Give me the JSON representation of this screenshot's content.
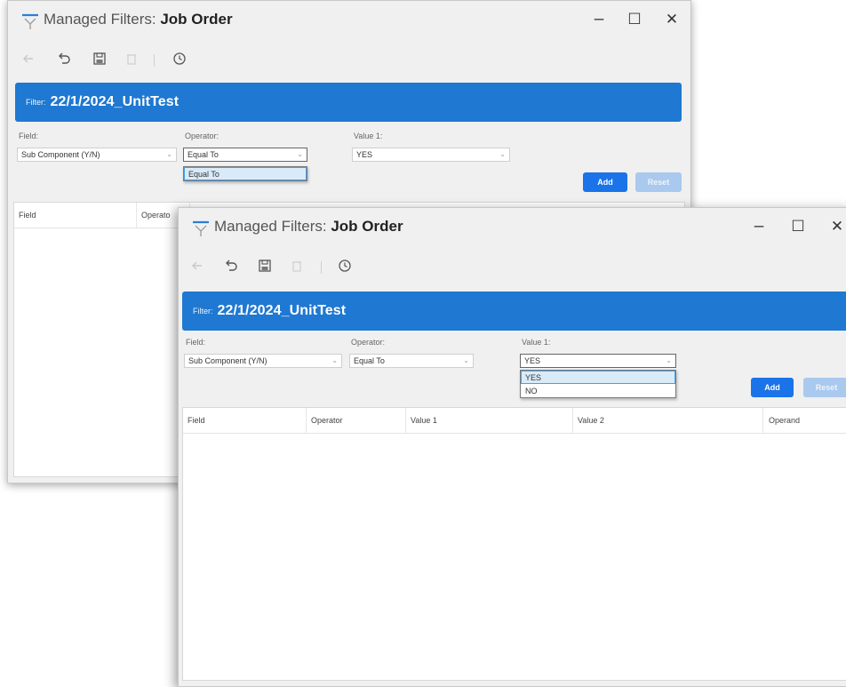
{
  "colors": {
    "accent": "#1f78d1",
    "add_button": "#1a73e8",
    "reset_button": "#a9c9ee"
  },
  "windows": [
    {
      "title_prefix": "Managed Filters: ",
      "title_entity": "Job Order",
      "window_controls": {
        "minimize": "–",
        "maximize": "☐",
        "close": "✕"
      },
      "toolbar_icons": [
        "back-arrow-icon",
        "undo-icon",
        "save-icon",
        "delete-icon",
        "history-icon"
      ],
      "filter_label": "Filter:",
      "filter_name": "22/1/2024_UnitTest",
      "field_label": "Field:",
      "field_value": "Sub Component (Y/N)",
      "operator_label": "Operator:",
      "operator_value": "Equal To",
      "value1_label": "Value 1:",
      "value1_value": "YES",
      "operator_dropdown": {
        "open": true,
        "options": [
          "Equal To"
        ],
        "selected": "Equal To"
      },
      "add_label": "Add",
      "reset_label": "Reset",
      "columns": [
        "Field",
        "Operato"
      ]
    },
    {
      "title_prefix": "Managed Filters: ",
      "title_entity": "Job Order",
      "window_controls": {
        "minimize": "–",
        "maximize": "☐",
        "close": "✕"
      },
      "toolbar_icons": [
        "back-arrow-icon",
        "undo-icon",
        "save-icon",
        "delete-icon",
        "history-icon"
      ],
      "filter_label": "Filter:",
      "filter_name": "22/1/2024_UnitTest",
      "field_label": "Field:",
      "field_value": "Sub Component (Y/N)",
      "operator_label": "Operator:",
      "operator_value": "Equal To",
      "value1_label": "Value 1:",
      "value1_value": "YES",
      "value1_dropdown": {
        "open": true,
        "options": [
          "YES",
          "NO"
        ],
        "selected": "YES"
      },
      "add_label": "Add",
      "reset_label": "Reset",
      "columns": [
        "Field",
        "Operator",
        "Value 1",
        "Value 2",
        "Operand"
      ]
    }
  ]
}
